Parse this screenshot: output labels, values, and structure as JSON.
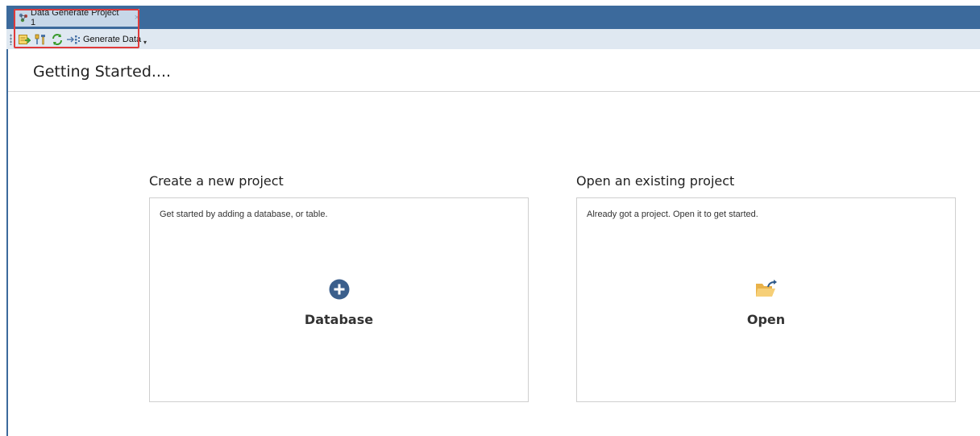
{
  "document_tab": {
    "title": "Data Generate Project 1",
    "close_glyph": "×",
    "icon": "project-icon"
  },
  "toolbar": {
    "buttons": [
      {
        "icon": "add-database-icon"
      },
      {
        "icon": "settings-icon"
      },
      {
        "icon": "refresh-icon"
      },
      {
        "icon": "generate-data-icon",
        "label": "Generate Data"
      }
    ],
    "overflow_glyph": "▾"
  },
  "page": {
    "title": "Getting Started...."
  },
  "create_section": {
    "heading": "Create a new project",
    "description": "Get started by adding a database, or table.",
    "action_label": "Database",
    "icon": "plus-circle-icon"
  },
  "open_section": {
    "heading": "Open an existing project",
    "description": "Already got a project. Open it to get started.",
    "action_label": "Open",
    "icon": "folder-open-icon"
  },
  "colors": {
    "title_bar": "#3c6a9c",
    "toolbar": "#dfe8f1",
    "highlight_border": "#e03a3a",
    "plus_icon": "#3b5f8c",
    "folder_icon": "#f0c060"
  }
}
